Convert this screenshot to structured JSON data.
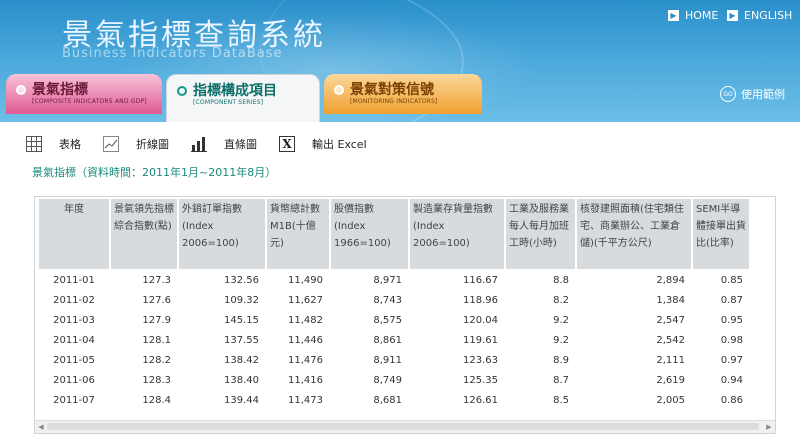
{
  "header": {
    "title": "景氣指標查詢系統",
    "subtitle": "Business Indicators DataBase",
    "links": [
      {
        "label": "HOME"
      },
      {
        "label": "ENGLISH"
      }
    ],
    "example_label": "使用範例",
    "go_icon_text": "GO"
  },
  "tabs": [
    {
      "label": "景氣指標",
      "sub": "[COMPOSITE INDICATORS AND GDP]"
    },
    {
      "label": "指標構成項目",
      "sub": "[COMPONENT SERIES]"
    },
    {
      "label": "景氣對策信號",
      "sub": "[MONITORING INDICATORS]"
    }
  ],
  "toolbar": {
    "table_label": "表格",
    "line_label": "折線圖",
    "bar_label": "直條圖",
    "excel_label": "輸出 Excel",
    "excel_icon": "X"
  },
  "caption": "景氣指標（資料時間：2011年1月~2011年8月）",
  "table": {
    "headers": [
      "年度",
      "景氣領先指標綜合指數(點)",
      "外銷訂單指數(Index 2006=100)",
      "貨幣總計數M1B(十億元)",
      "股價指數(Index 1966=100)",
      "製造業存貨量指數(Index 2006=100)",
      "工業及服務業每人每月加班工時(小時)",
      "核發建照面積(住宅類住宅、商業辦公、工業倉儲)(千平方公尺)",
      "SEMI半導體接單出貨比(比率)"
    ],
    "rows": [
      [
        "2011-01",
        "127.3",
        "132.56",
        "11,490",
        "8,971",
        "116.67",
        "8.8",
        "2,894",
        "0.85"
      ],
      [
        "2011-02",
        "127.6",
        "109.32",
        "11,627",
        "8,743",
        "118.96",
        "8.2",
        "1,384",
        "0.87"
      ],
      [
        "2011-03",
        "127.9",
        "145.15",
        "11,482",
        "8,575",
        "120.04",
        "9.2",
        "2,547",
        "0.95"
      ],
      [
        "2011-04",
        "128.1",
        "137.55",
        "11,446",
        "8,861",
        "119.61",
        "9.2",
        "2,542",
        "0.98"
      ],
      [
        "2011-05",
        "128.2",
        "138.42",
        "11,476",
        "8,911",
        "123.63",
        "8.9",
        "2,111",
        "0.97"
      ],
      [
        "2011-06",
        "128.3",
        "138.40",
        "11,416",
        "8,749",
        "125.35",
        "8.7",
        "2,619",
        "0.94"
      ],
      [
        "2011-07",
        "128.4",
        "139.44",
        "11,473",
        "8,681",
        "126.61",
        "8.5",
        "2,005",
        "0.86"
      ]
    ]
  },
  "colors": {
    "header_blue": "#2a8fca",
    "tab_pink": "#e05a93",
    "tab_active_text": "#0b6f6a",
    "tab_orange": "#f0a030",
    "caption_teal": "#1a8a7a"
  }
}
